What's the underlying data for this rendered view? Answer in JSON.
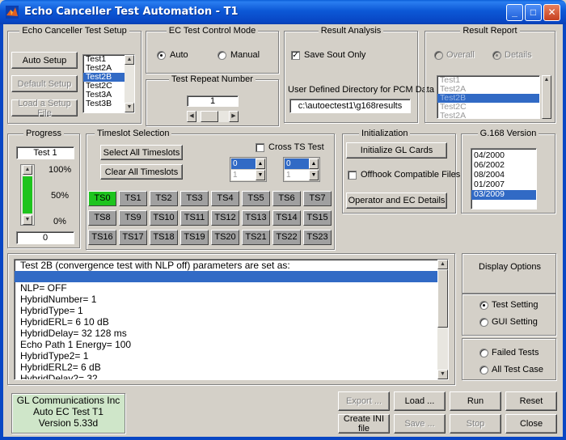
{
  "window": {
    "title": "Echo Canceller Test Automation - T1",
    "min": "_",
    "max": "□",
    "close": "✕"
  },
  "setup": {
    "title": "Echo Canceller Test Setup",
    "auto_setup": "Auto Setup",
    "default_setup": "Default Setup",
    "load_setup_file": "Load a Setup File",
    "tests": [
      "Test1",
      "Test2A",
      "Test2B",
      "Test2C",
      "Test3A",
      "Test3B"
    ],
    "selected": "Test2B"
  },
  "control_mode": {
    "title": "EC Test Control Mode",
    "auto": "Auto",
    "manual": "Manual",
    "selected": "Auto"
  },
  "repeat": {
    "title": "Test Repeat Number",
    "value": "1"
  },
  "analysis": {
    "title": "Result Analysis",
    "save_sout_only": "Save Sout Only",
    "save_sout_checked": true,
    "dir_label": "User Defined Directory for PCM Data",
    "dir_value": "c:\\autoectest1\\g168results"
  },
  "report": {
    "title": "Result Report",
    "overall": "Overall",
    "details": "Details",
    "tests": [
      "Test1",
      "Test2A",
      "Test2B",
      "Test2C",
      "Test2A"
    ],
    "selected": "Test2B"
  },
  "progress": {
    "title": "Progress",
    "current_test": "Test 1",
    "pct_100": "100%",
    "pct_50": "50%",
    "pct_0": "0%",
    "count": "0",
    "fill_fraction": 1.0
  },
  "timeslots": {
    "title": "Timeslot Selection",
    "select_all": "Select All Timeslots",
    "clear_all": "Clear All Timeslots",
    "cross_ts": "Cross TS Test",
    "pop1": [
      "0",
      "1"
    ],
    "pop2": [
      "0",
      "1"
    ],
    "slots": [
      "TS0",
      "TS1",
      "TS2",
      "TS3",
      "TS4",
      "TS5",
      "TS6",
      "TS7",
      "TS8",
      "TS9",
      "TS10",
      "TS11",
      "TS12",
      "TS13",
      "TS14",
      "TS15",
      "TS16",
      "TS17",
      "TS18",
      "TS19",
      "TS20",
      "TS21",
      "TS22",
      "TS23"
    ],
    "active": "TS0"
  },
  "init": {
    "title": "Initialization",
    "init_gl": "Initialize GL Cards",
    "offhook": "Offhook Compatible Files",
    "operator": "Operator and EC Details"
  },
  "g168": {
    "title": "G.168 Version",
    "versions": [
      "04/2000",
      "06/2002",
      "08/2004",
      "01/2007",
      "03/2009"
    ],
    "selected": "03/2009"
  },
  "console": {
    "lines": [
      "Test 2B (convergence test with NLP off) parameters are set as:",
      "",
      "NLP=  OFF",
      "HybridNumber= 1",
      "HybridType= 1",
      "HybridERL= 6 10 dB",
      "HybridDelay= 32  128 ms",
      "Echo Path 1 Energy= 100",
      "HybridType2= 1",
      "HybridERL2= 6 dB",
      "HybridDelay2= 32"
    ]
  },
  "display": {
    "title": "Display Options",
    "test_setting": "Test Setting",
    "gui_setting": "GUI Setting",
    "failed_tests": "Failed Tests",
    "all_test_case": "All Test Case"
  },
  "footer": {
    "company": "GL Communications Inc",
    "product": "Auto EC Test T1",
    "version": "Version 5.33d",
    "export": "Export ...",
    "load": "Load ...",
    "run": "Run",
    "reset": "Reset",
    "create_ini": "Create INI file",
    "save": "Save ...",
    "stop": "Stop",
    "close": "Close"
  }
}
